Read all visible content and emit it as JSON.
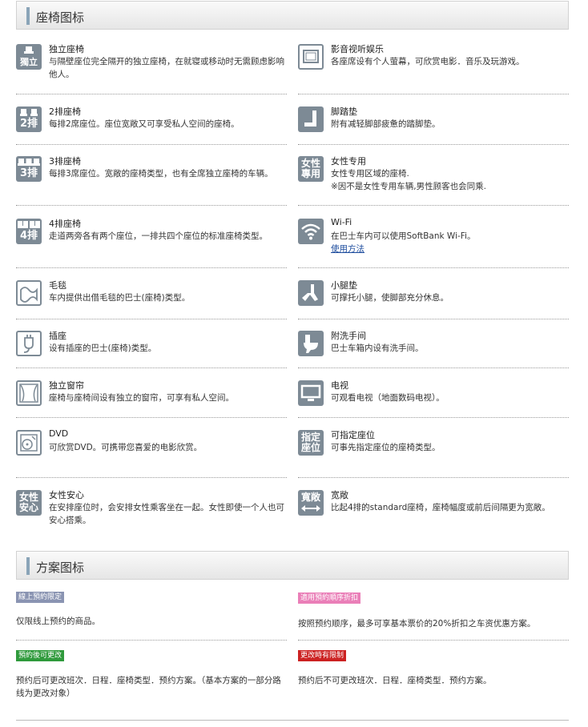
{
  "sections": {
    "seat_icons_title": "座椅图标",
    "plan_icons_title": "方案图标"
  },
  "seat_items": [
    {
      "icon": "solo-seat-icon",
      "icon_text": "獨立",
      "title": "独立座椅",
      "desc": "与隔壁座位完全隔开的独立座椅，在就寝或移动时无需顾虑影响他人。"
    },
    {
      "icon": "video-entertainment-icon",
      "icon_text": "",
      "title": "影音视听娱乐",
      "desc": "各座席设有个人萤幕，可欣赏电影．音乐及玩游戏。"
    },
    {
      "icon": "two-row-seat-icon",
      "icon_text": "2排",
      "title": "2排座椅",
      "desc": "每排2席座位。座位宽敞又可享受私人空间的座椅。"
    },
    {
      "icon": "footrest-icon",
      "icon_text": "",
      "title": "脚踏垫",
      "desc": "附有减轻脚部疲惫的踏脚垫。"
    },
    {
      "icon": "three-row-seat-icon",
      "icon_text": "3排",
      "title": "3排座椅",
      "desc": "每排3席座位。宽敞的座椅类型，也有全席独立座椅的车辆。"
    },
    {
      "icon": "women-only-icon",
      "icon_text": "女性專用",
      "title": "女性专用",
      "desc": "女性专用区域的座椅.",
      "desc2": "※因不是女性专用车辆,男性顾客也会同乘."
    },
    {
      "icon": "four-row-seat-icon",
      "icon_text": "4排",
      "title": "4排座椅",
      "desc": "走道两旁各有两个座位，一排共四个座位的标准座椅类型。"
    },
    {
      "icon": "wifi-icon",
      "icon_text": "",
      "title": "Wi-Fi",
      "desc": "在巴士车内可以使用SoftBank Wi-Fi。",
      "link": "使用方法"
    },
    {
      "icon": "blanket-icon",
      "icon_text": "",
      "title": "毛毯",
      "desc": "车内提供出借毛毯的巴士(座椅)类型。"
    },
    {
      "icon": "leg-rest-icon",
      "icon_text": "",
      "title": "小腿垫",
      "desc": "可撑托小腿，使脚部充分休息。"
    },
    {
      "icon": "power-outlet-icon",
      "icon_text": "",
      "title": "插座",
      "desc": "设有插座的巴士(座椅)类型。"
    },
    {
      "icon": "toilet-icon",
      "icon_text": "",
      "title": "附洗手间",
      "desc": "巴士车箱内设有洗手间。"
    },
    {
      "icon": "curtain-icon",
      "icon_text": "",
      "title": "独立窗帘",
      "desc": "座椅与座椅间设有独立的窗帘，可享有私人空间。"
    },
    {
      "icon": "tv-icon",
      "icon_text": "",
      "title": "电视",
      "desc": "可观看电视（地面数码电视）。"
    },
    {
      "icon": "dvd-icon",
      "icon_text": "",
      "title": "DVD",
      "desc": "可欣赏DVD。可携带您喜爱的电影欣赏。"
    },
    {
      "icon": "reserved-seat-icon",
      "icon_text": "指定座位",
      "title": "可指定座位",
      "desc": "可事先指定座位的座椅类型。"
    },
    {
      "icon": "women-safe-icon",
      "icon_text": "女性安心",
      "title": "女性安心",
      "desc": "在安排座位时，会安排女性乘客坐在一起。女性即使一个人也可安心搭乘。"
    },
    {
      "icon": "wide-seat-icon",
      "icon_text": "寬敞",
      "title": "宽敞",
      "desc": "比起4排的standard座椅，座椅幅度或前后间隔更为宽敞。"
    }
  ],
  "plans": [
    {
      "badge": "線上預約限定",
      "color": "#8a94b2",
      "desc": "仅限线上预约的商品。"
    },
    {
      "badge": "適用預約順序折扣",
      "color": "#ea7fb8",
      "desc": "按照预约顺序，最多可享基本票价的20%折扣之车资优惠方案。"
    },
    {
      "badge": "預約後可更改",
      "color": "#2f9a3c",
      "desc": "预约后可更改班次．日程．座椅类型．预约方案。（基本方案的一部分路线为更改对象）"
    },
    {
      "badge": "更改時有限制",
      "color": "#cc2222",
      "desc": "预约后不可更改班次．日程．座椅类型．预约方案。"
    }
  ]
}
